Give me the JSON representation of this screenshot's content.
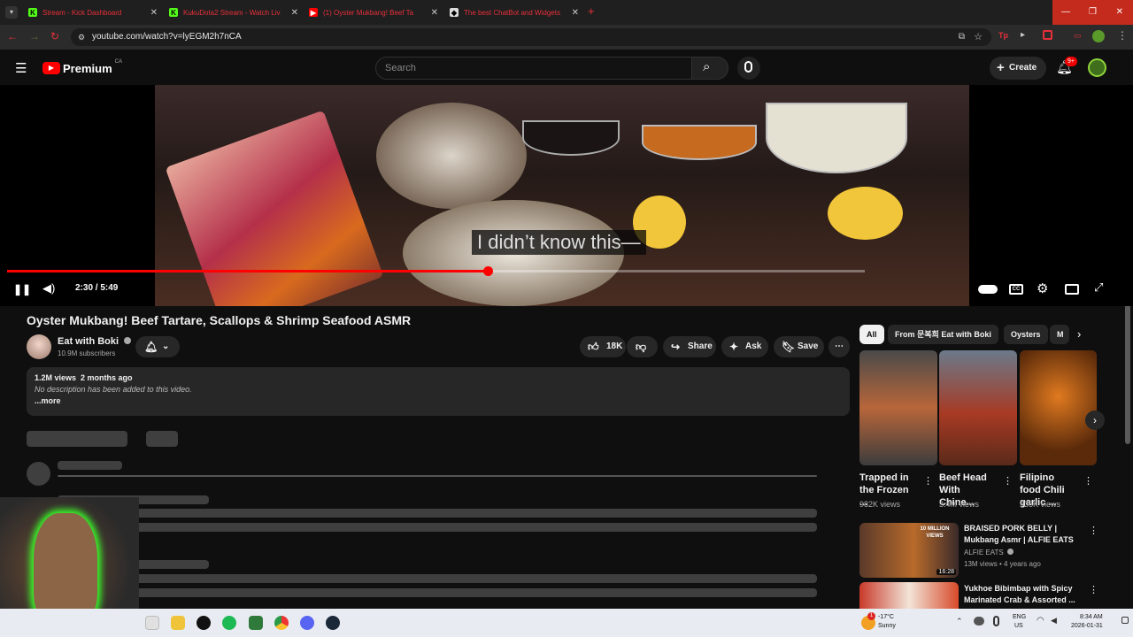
{
  "browser": {
    "tabs": [
      {
        "label": "Stream - Kick Dashboard",
        "favicon": "kick-icon"
      },
      {
        "label": "KukuDota2 Stream - Watch Liv",
        "favicon": "kick-icon"
      },
      {
        "label": "(1) Oyster Mukbang! Beef Ta",
        "favicon": "youtube-icon"
      },
      {
        "label": "The best ChatBot and Widgets",
        "favicon": "botrix-icon"
      }
    ],
    "url": "youtube.com/watch?v=lyEGM2h7nCA",
    "accent": "#e8303a"
  },
  "header": {
    "logo_text": "Premium",
    "region": "CA",
    "search_placeholder": "Search",
    "create_label": "Create",
    "notif_badge": "9+"
  },
  "player": {
    "caption": "I didn’t know this—",
    "timecode": "2:30 / 5:49",
    "progress": 0.56
  },
  "video": {
    "title": "Oyster Mukbang! Beef Tartare, Scallops & Shrimp Seafood ASMR",
    "channel": "Eat with Boki",
    "subscribers": "10.9M subscribers",
    "likes": "18K",
    "share_label": "Share",
    "ask_label": "Ask",
    "save_label": "Save",
    "views": "1.2M views",
    "age": "2 months ago",
    "description": "No description has been added to this video.",
    "more_label": "...more"
  },
  "sidebar": {
    "chips": [
      "All",
      "From 문복희 Eat with Boki",
      "Oysters",
      "M"
    ],
    "shorts": [
      {
        "title": "Trapped in the Frozen ...",
        "views": "982K views"
      },
      {
        "title": "Beef Head With Chine...",
        "views": "3.4M views"
      },
      {
        "title": "Filipino food Chili garlic ...",
        "views": "935K views"
      }
    ],
    "recommendations": [
      {
        "title": "BRAISED PORK BELLY | Mukbang Asmr | ALFIE EATS",
        "channel": "ALFIE EATS",
        "meta": "13M views • 4 years ago",
        "duration": "16:28",
        "badge": "10 MILLION VIEWS"
      },
      {
        "title": "Yukhoe Bibimbap with Spicy Marinated Crab & Assorted ...",
        "channel": "",
        "meta": "",
        "duration": ""
      }
    ]
  },
  "taskbar": {
    "weather_temp": "-17°C",
    "weather_desc": "Sunny",
    "weather_badge": "1",
    "lang_line1": "ENG",
    "lang_line2": "US",
    "time": "8:34 AM",
    "date": "2026-01-31"
  }
}
